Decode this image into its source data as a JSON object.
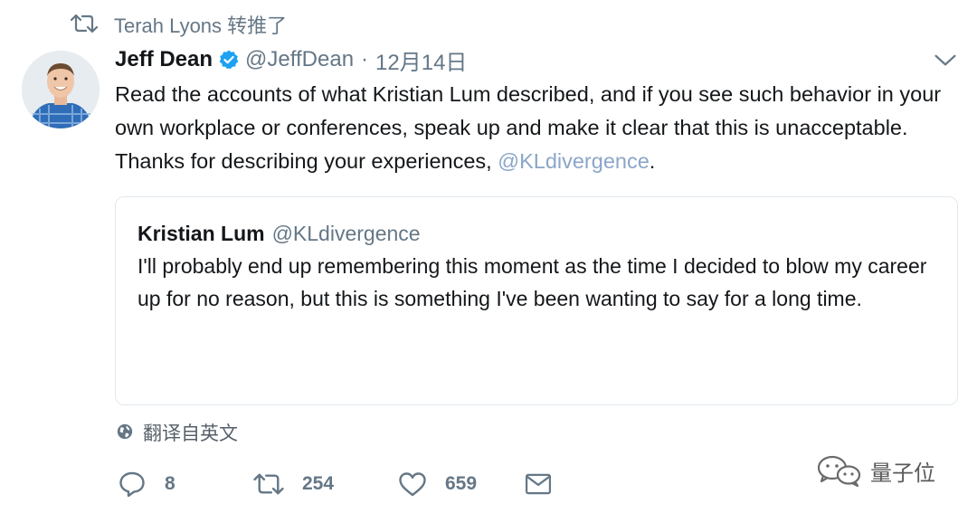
{
  "retweet_context": {
    "icon": "retweet-icon",
    "text": "Terah Lyons 转推了"
  },
  "tweet": {
    "author_name": "Jeff Dean",
    "verified": true,
    "handle": "@JeffDean",
    "separator": "·",
    "time": "12月14日",
    "text_before_mention": "Read the accounts of what Kristian Lum described, and if you see such behavior in your own workplace or conferences, speak up and make it clear that this is unacceptable.  Thanks for describing your experiences, ",
    "mention": "@KLdivergence",
    "text_after_mention": "."
  },
  "quoted_tweet": {
    "author_name": "Kristian Lum",
    "handle": "@KLdivergence",
    "text": "I'll probably end up remembering this moment as the time I decided to blow my career up for no reason, but this is something I've been wanting to say for a long time."
  },
  "translate": {
    "icon": "globe-icon",
    "label": "翻译自英文"
  },
  "actions": {
    "reply_count": "8",
    "retweet_count": "254",
    "like_count": "659"
  },
  "watermark": {
    "icon": "wechat-icon",
    "text": "量子位"
  },
  "colors": {
    "text": "#14171a",
    "secondary": "#657786",
    "link": "#8aa6c8",
    "verified": "#1da1f2",
    "border": "#e1e8ed"
  }
}
